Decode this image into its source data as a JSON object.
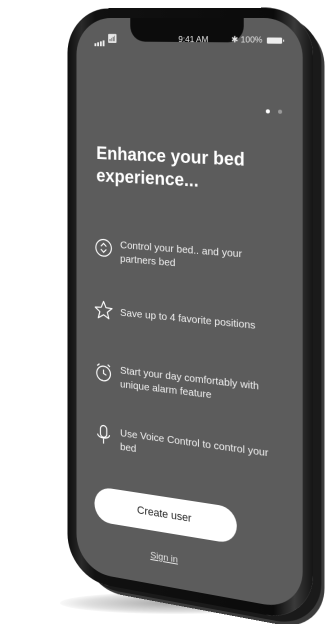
{
  "status_bar": {
    "time": "9:41 AM",
    "battery": "100%"
  },
  "pager": {
    "total": 2,
    "active": 1
  },
  "headline": "Enhance your bed experience...",
  "features": [
    {
      "icon": "control-chevrons-icon",
      "text": "Control your bed.. and your partners bed"
    },
    {
      "icon": "star-icon",
      "text": "Save up to 4 favorite positions"
    },
    {
      "icon": "alarm-clock-icon",
      "text": "Start your day comfortably with unique alarm feature"
    },
    {
      "icon": "microphone-icon",
      "text": "Use Voice Control to control your bed"
    }
  ],
  "cta": {
    "label": "Create user"
  },
  "sign_in": {
    "label": "Sign in"
  },
  "colors": {
    "screen": "#5c5c5c",
    "text": "#ffffff",
    "button": "#ffffff"
  }
}
